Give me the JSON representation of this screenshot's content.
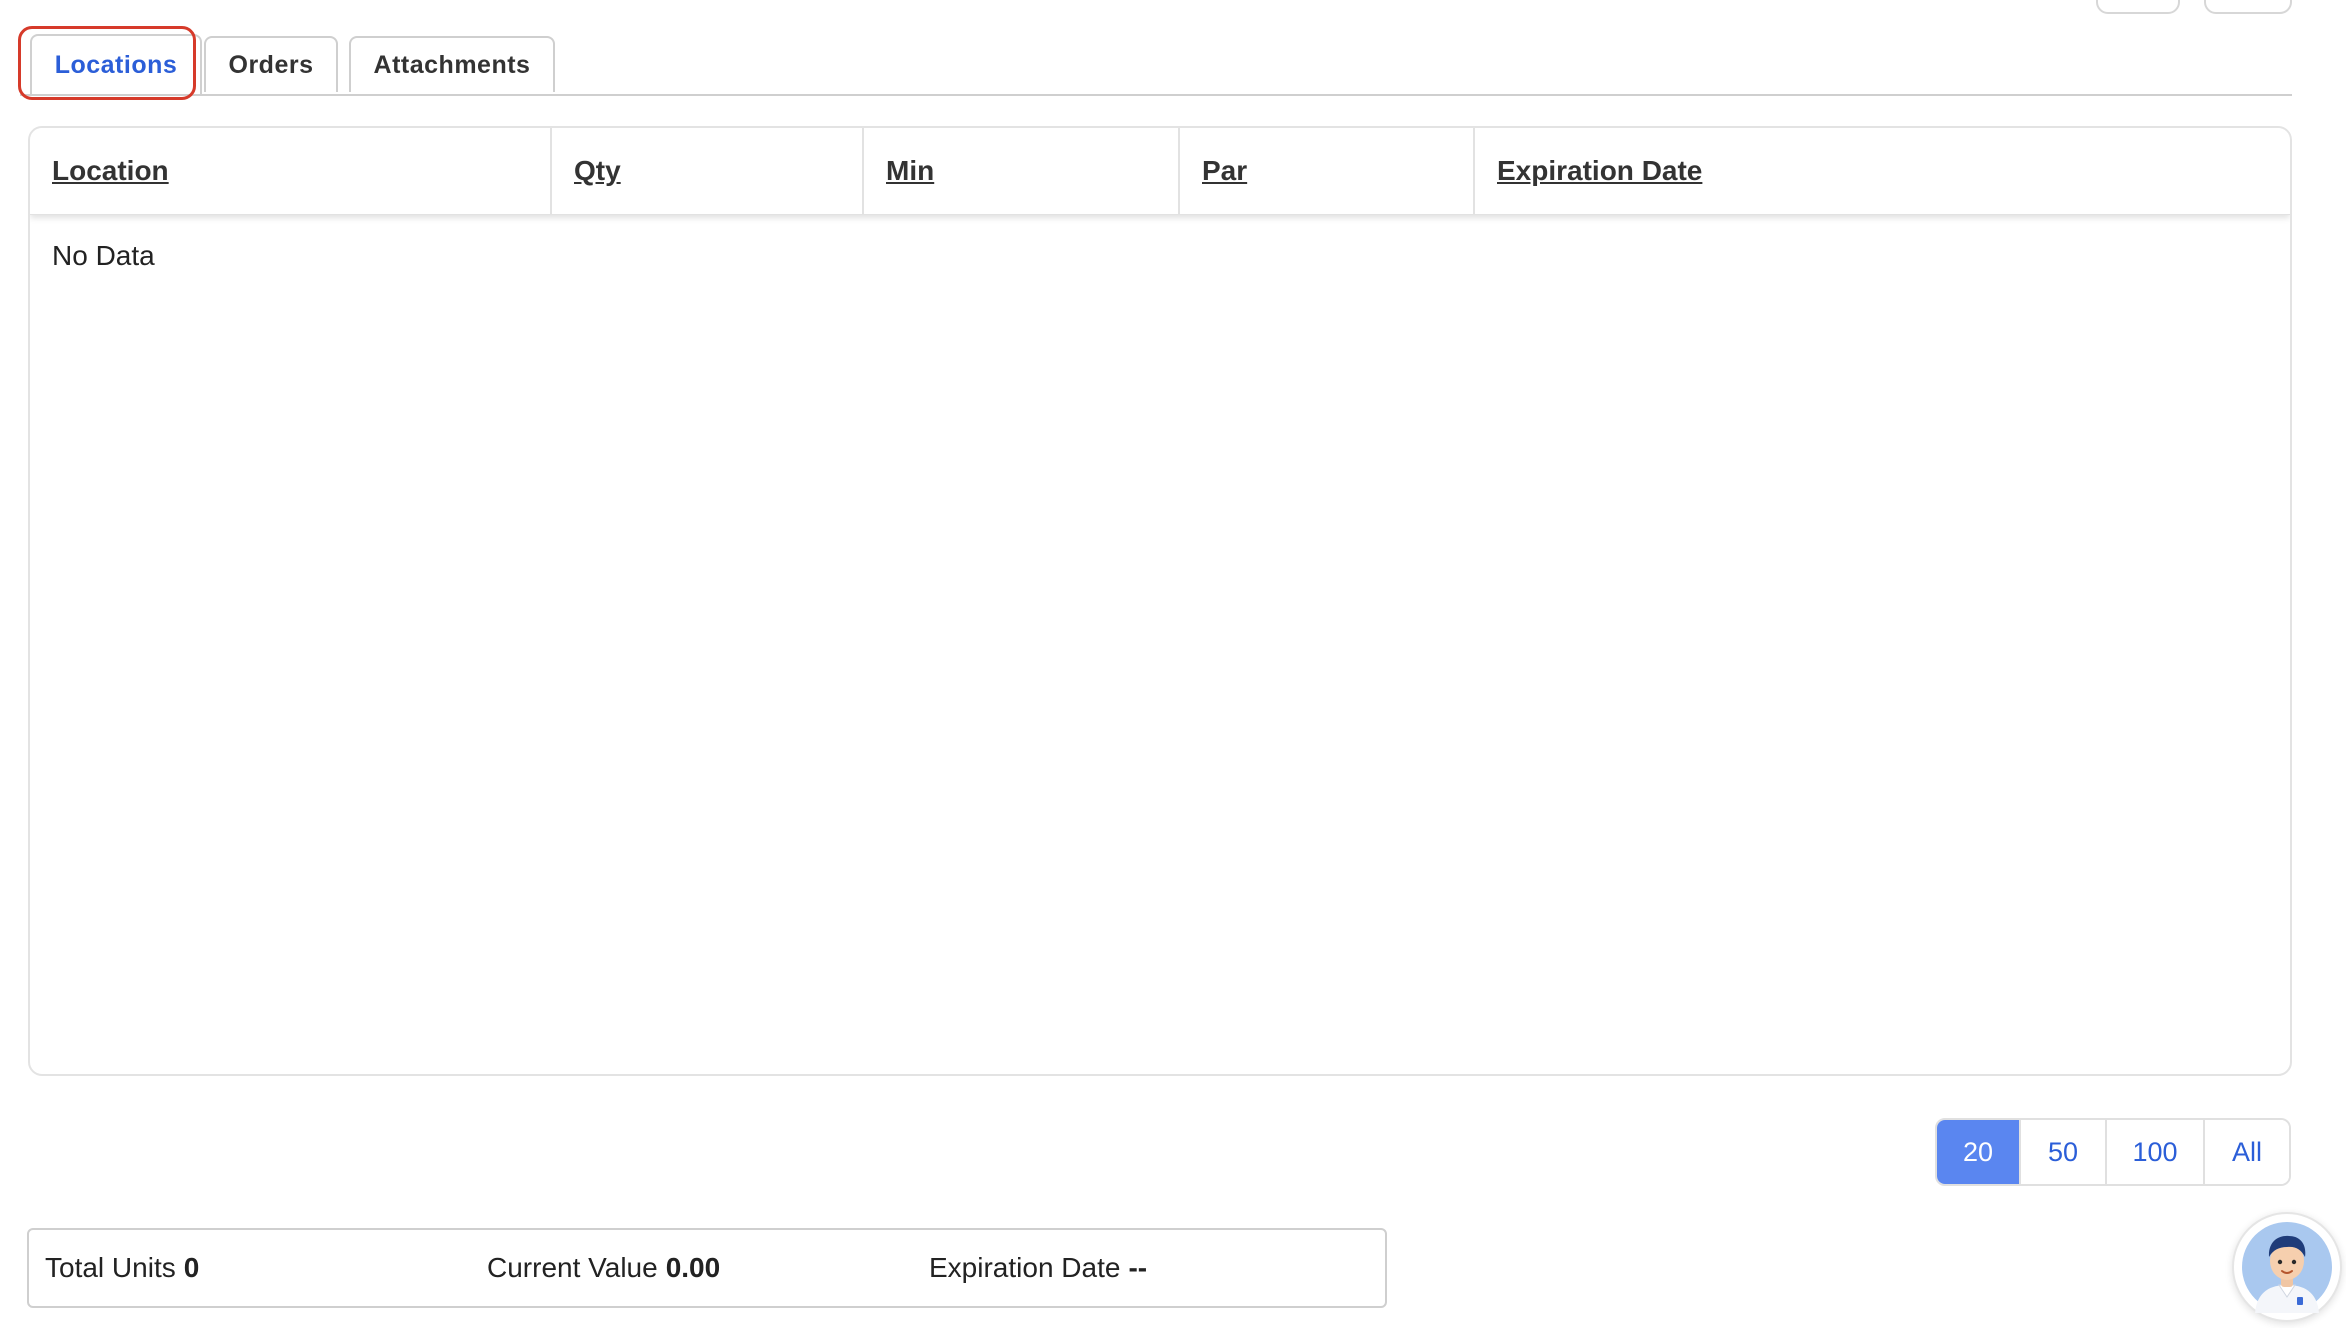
{
  "tabs": [
    {
      "label": "Locations",
      "active": true
    },
    {
      "label": "Orders",
      "active": false
    },
    {
      "label": "Attachments",
      "active": false
    }
  ],
  "table": {
    "columns": [
      "Location",
      "Qty",
      "Min",
      "Par",
      "Expiration Date"
    ],
    "rows": [],
    "empty_text": "No Data"
  },
  "pagination": {
    "options": [
      "20",
      "50",
      "100",
      "All"
    ],
    "selected": "20"
  },
  "summary": {
    "total_units_label": "Total Units",
    "total_units_value": "0",
    "current_value_label": "Current Value",
    "current_value_value": "0.00",
    "expiration_label": "Expiration Date",
    "expiration_value": "--"
  },
  "colors": {
    "accent": "#2b5ed8",
    "selected_page_bg": "#5a86f0",
    "highlight_outline": "#d63a2a"
  },
  "icons": {
    "assistant": "assistant-avatar-icon"
  }
}
